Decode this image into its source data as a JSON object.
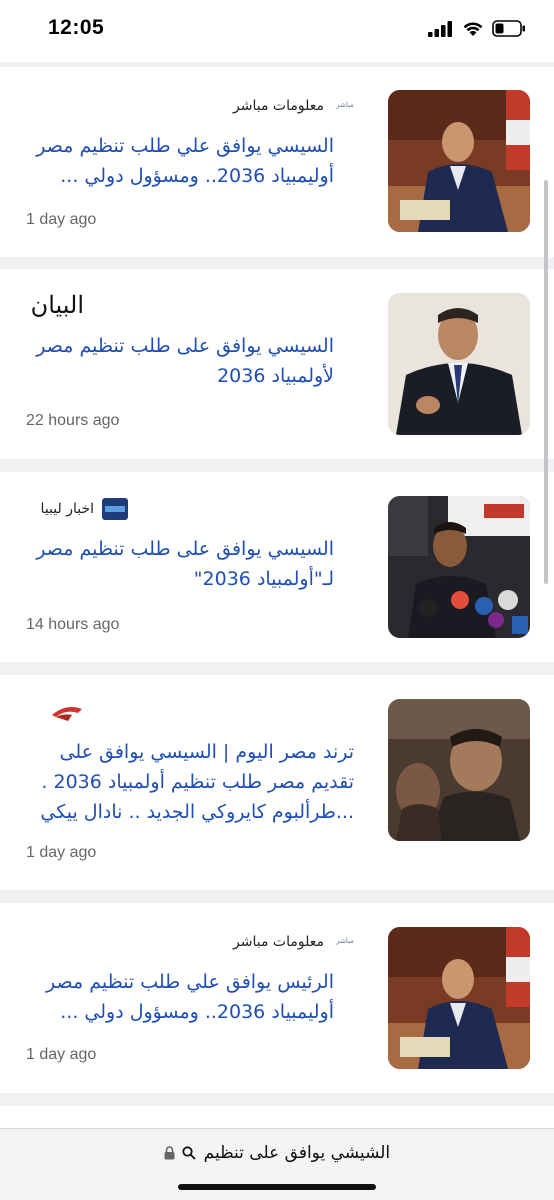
{
  "status": {
    "time": "12:05"
  },
  "cards": [
    {
      "source": "معلومات مباشر",
      "logo_text": "مباشر",
      "headline_l1": "السيسي يوافق علي طلب تنظيم مصر",
      "headline_l2": "أوليمبياد 2036.. ومسؤول دولي ...",
      "headline_l3": "",
      "time": "1 day ago"
    },
    {
      "source": "البيان",
      "logo_text": "",
      "headline_l1": "السيسي يوافق على طلب تنظيم مصر",
      "headline_l2": "لأولمبياد 2036",
      "headline_l3": "",
      "time": "22 hours ago"
    },
    {
      "source": "اخبار ليبيا",
      "logo_text": "",
      "headline_l1": "السيسي يوافق على طلب تنظيم مصر",
      "headline_l2": "لـ\"أولمبياد 2036\"",
      "headline_l3": "",
      "time": "14 hours ago"
    },
    {
      "source": "",
      "logo_text": "",
      "headline_l1": "ترند مصر اليوم | السيسي يوافق على",
      "headline_l2": "تقديم مصر طلب تنظيم أولمبياد 2036 .",
      "headline_l3": "...طرألبوم كايروكي الجديد .. نادال ييكي",
      "time": "1 day ago"
    },
    {
      "source": "معلومات مباشر",
      "logo_text": "مباشر",
      "headline_l1": "الرئيس يوافق علي طلب تنظيم مصر",
      "headline_l2": "أوليمبياد 2036.. ومسؤول دولي ...",
      "headline_l3": "",
      "time": "1 day ago"
    }
  ],
  "address_bar": {
    "query": "الشيشي يوافق على تنظيم"
  },
  "colors": {
    "headline": "#1f4fb4",
    "background": "#f1f1f4"
  }
}
